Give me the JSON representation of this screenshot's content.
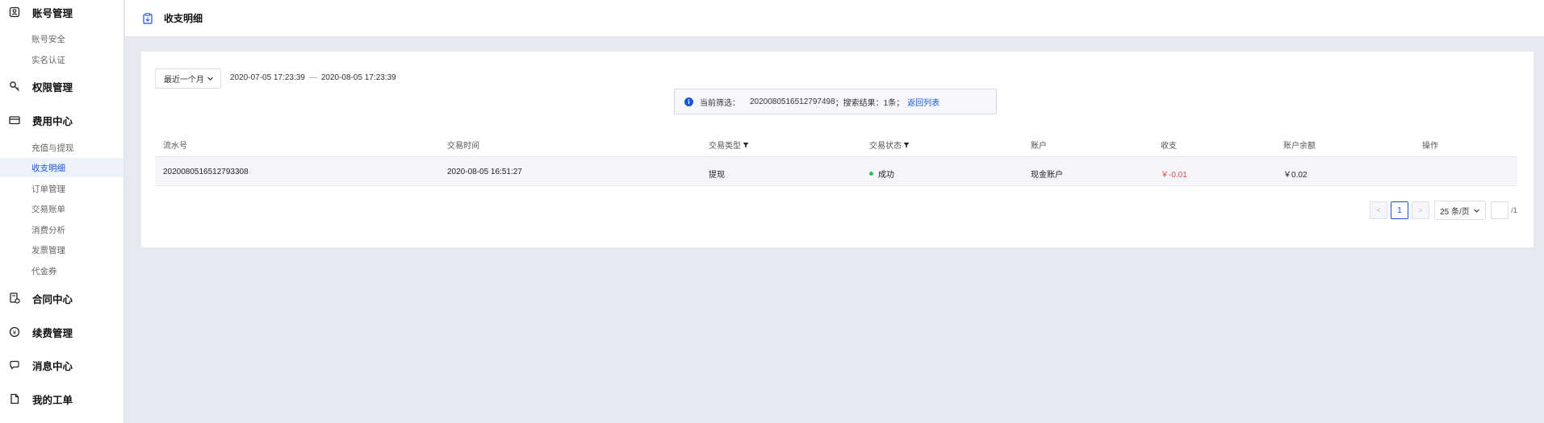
{
  "sidebar": {
    "groups": [
      {
        "label": "账号管理",
        "icon": "account-icon",
        "subs": [
          "账号安全",
          "实名认证"
        ]
      },
      {
        "label": "权限管理",
        "icon": "key-icon",
        "subs": []
      },
      {
        "label": "费用中心",
        "icon": "card-icon",
        "subs": [
          "充值与提现",
          "收支明细",
          "订单管理",
          "交易账单",
          "消费分析",
          "发票管理",
          "代金券"
        ]
      },
      {
        "label": "合同中心",
        "icon": "contract-icon",
        "subs": []
      },
      {
        "label": "续费管理",
        "icon": "renew-icon",
        "subs": []
      },
      {
        "label": "消息中心",
        "icon": "message-icon",
        "subs": []
      },
      {
        "label": "我的工单",
        "icon": "ticket-icon",
        "subs": []
      }
    ],
    "active_sub": "收支明细"
  },
  "header": {
    "title": "收支明细",
    "icon": "clipboard-icon"
  },
  "filters": {
    "range_select": "最近一个月",
    "range_start": "2020-07-05 17:23:39",
    "range_sep": "—",
    "range_end": "2020-08-05 17:23:39"
  },
  "search_info": {
    "prefix": "当前筛选：",
    "query": "20200805165127974​98",
    "result": "；搜索结果：1条；",
    "back_link": "返回列表"
  },
  "table": {
    "columns": [
      "流水号",
      "交易时间",
      "交易类型",
      "交易状态",
      "账户",
      "收支",
      "账户余额",
      "操作"
    ],
    "rows": [
      {
        "serial": "20200805165127933​08",
        "time": "2020-08-05 16:51:27",
        "type": "提现",
        "status": "成功",
        "account": "现金账户",
        "amount": "￥-0.01",
        "balance": "￥0.02",
        "action": ""
      }
    ]
  },
  "pagination": {
    "prev": "<",
    "current": "1",
    "next": ">",
    "page_size": "25 条/页",
    "total": "/1"
  },
  "colors": {
    "accent": "#1a56db",
    "negative": "#e54545",
    "success": "#27c24c"
  }
}
